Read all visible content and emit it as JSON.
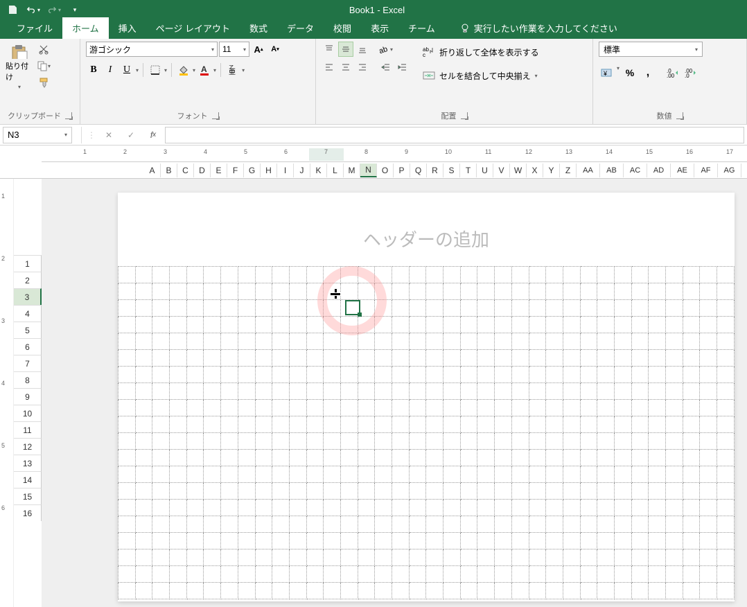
{
  "app": {
    "title": "Book1  -  Excel"
  },
  "tabs": {
    "file": "ファイル",
    "home": "ホーム",
    "insert": "挿入",
    "page_layout": "ページ レイアウト",
    "formulas": "数式",
    "data": "データ",
    "review": "校閲",
    "view": "表示",
    "team": "チーム"
  },
  "tellme": {
    "placeholder": "実行したい作業を入力してください"
  },
  "ribbon": {
    "clipboard": {
      "paste": "貼り付け",
      "label": "クリップボード"
    },
    "font": {
      "name": "游ゴシック",
      "size": "11",
      "label": "フォント"
    },
    "alignment": {
      "wrap": "折り返して全体を表示する",
      "merge": "セルを結合して中央揃え",
      "label": "配置"
    },
    "number": {
      "format": "標準",
      "label": "数値"
    }
  },
  "namebox": {
    "value": "N3"
  },
  "formula_bar": {
    "value": ""
  },
  "ruler": {
    "ticks": [
      "1",
      "2",
      "3",
      "4",
      "5",
      "6",
      "7",
      "8",
      "9",
      "10",
      "11",
      "12",
      "13",
      "14",
      "15",
      "16",
      "17"
    ],
    "highlight_index": 6
  },
  "columns": [
    "A",
    "B",
    "C",
    "D",
    "E",
    "F",
    "G",
    "H",
    "I",
    "J",
    "K",
    "L",
    "M",
    "N",
    "O",
    "P",
    "Q",
    "R",
    "S",
    "T",
    "U",
    "V",
    "W",
    "X",
    "Y",
    "Z",
    "AA",
    "AB",
    "AC",
    "AD",
    "AE",
    "AF",
    "AG"
  ],
  "selected_col": "N",
  "rows": [
    "1",
    "2",
    "3",
    "4",
    "5",
    "6",
    "7",
    "8",
    "9",
    "10",
    "11",
    "12",
    "13",
    "14",
    "15",
    "16"
  ],
  "selected_row": "3",
  "page": {
    "header_placeholder": "ヘッダーの追加"
  },
  "icons": {
    "save": "save-icon",
    "undo": "undo-icon",
    "redo": "redo-icon",
    "cut": "cut-icon",
    "copy": "copy-icon",
    "format_painter": "format-painter-icon",
    "bold": "B",
    "italic": "I",
    "underline": "U",
    "grow": "A",
    "shrink": "A",
    "percent": "%",
    "comma": ","
  }
}
